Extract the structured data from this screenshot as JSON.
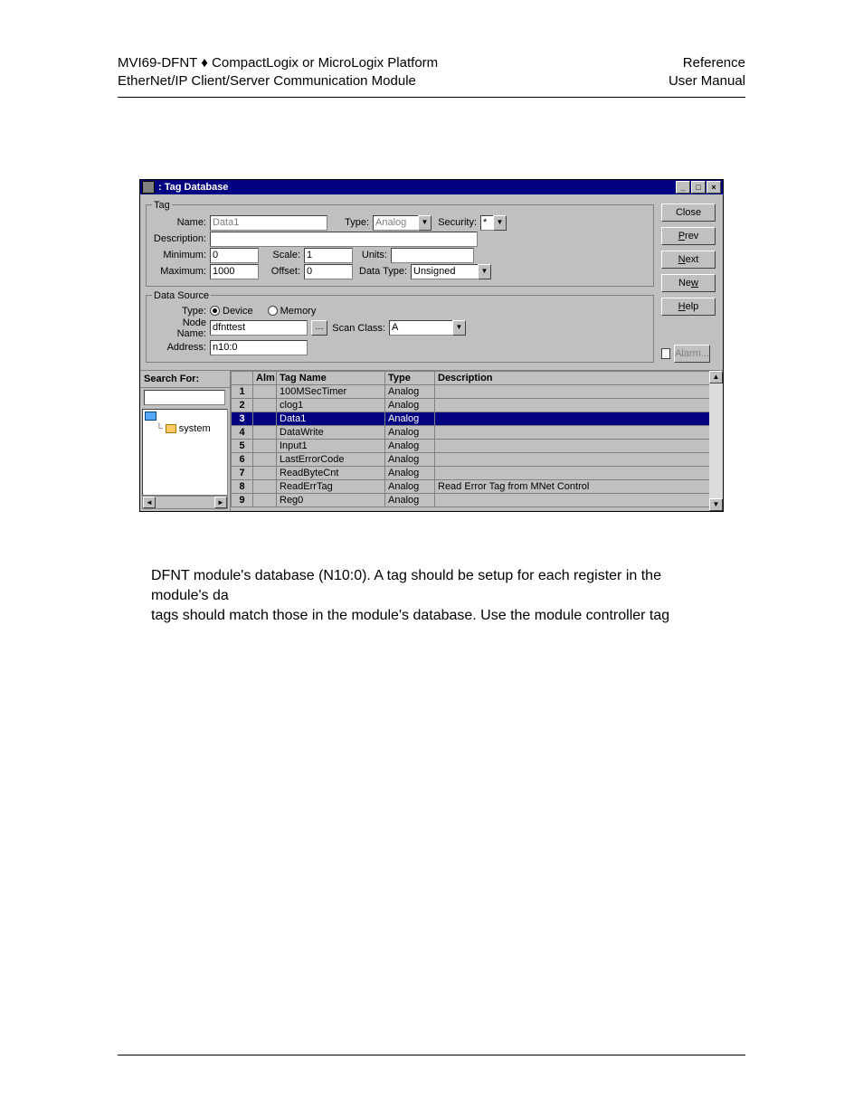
{
  "header": {
    "left_line1": "MVI69-DFNT ♦ CompactLogix or MicroLogix Platform",
    "left_line2": "EtherNet/IP Client/Server Communication Module",
    "right_line1": "Reference",
    "right_line2": "User Manual"
  },
  "window": {
    "title": ": Tag Database",
    "buttons": {
      "close": "Close",
      "prev": "Prev",
      "next": "Next",
      "new": "New",
      "help": "Help",
      "alarm": "Alarm..."
    },
    "tag_group": {
      "legend": "Tag",
      "name_label": "Name:",
      "name_value": "Data1",
      "type_label": "Type:",
      "type_value": "Analog",
      "security_label": "Security:",
      "security_value": "*",
      "description_label": "Description:",
      "description_value": "",
      "minimum_label": "Minimum:",
      "minimum_value": "0",
      "scale_label": "Scale:",
      "scale_value": "1",
      "units_label": "Units:",
      "units_value": "",
      "maximum_label": "Maximum:",
      "maximum_value": "1000",
      "offset_label": "Offset:",
      "offset_value": "0",
      "datatype_label": "Data Type:",
      "datatype_value": "Unsigned Integer"
    },
    "ds_group": {
      "legend": "Data Source",
      "type_label": "Type:",
      "radio_device": "Device",
      "radio_memory": "Memory",
      "node_label": "Node Name:",
      "node_value": "dfnttest",
      "scan_label": "Scan Class:",
      "scan_value": "A",
      "address_label": "Address:",
      "address_value": "n10:0"
    },
    "search_label": "Search For:",
    "tree": {
      "root": "system"
    },
    "grid": {
      "headers": {
        "alm": "Alm",
        "tag": "Tag Name",
        "type": "Type",
        "desc": "Description"
      },
      "rows": [
        {
          "n": "1",
          "alm": "",
          "tag": "100MSecTimer",
          "type": "Analog",
          "desc": ""
        },
        {
          "n": "2",
          "alm": "",
          "tag": "clog1",
          "type": "Analog",
          "desc": ""
        },
        {
          "n": "3",
          "alm": "",
          "tag": "Data1",
          "type": "Analog",
          "desc": "",
          "selected": true
        },
        {
          "n": "4",
          "alm": "",
          "tag": "DataWrite",
          "type": "Analog",
          "desc": ""
        },
        {
          "n": "5",
          "alm": "",
          "tag": "Input1",
          "type": "Analog",
          "desc": ""
        },
        {
          "n": "6",
          "alm": "",
          "tag": "LastErrorCode",
          "type": "Analog",
          "desc": ""
        },
        {
          "n": "7",
          "alm": "",
          "tag": "ReadByteCnt",
          "type": "Analog",
          "desc": ""
        },
        {
          "n": "8",
          "alm": "",
          "tag": "ReadErrTag",
          "type": "Analog",
          "desc": "Read Error Tag from MNet Control"
        },
        {
          "n": "9",
          "alm": "",
          "tag": "Reg0",
          "type": "Analog",
          "desc": ""
        }
      ]
    }
  },
  "paragraph": {
    "line1": "DFNT module's database (N10:0). A tag should be setup for each register in the",
    "line2": "module's da",
    "line3": "tags should match those in the module's database. Use the module controller tag"
  }
}
